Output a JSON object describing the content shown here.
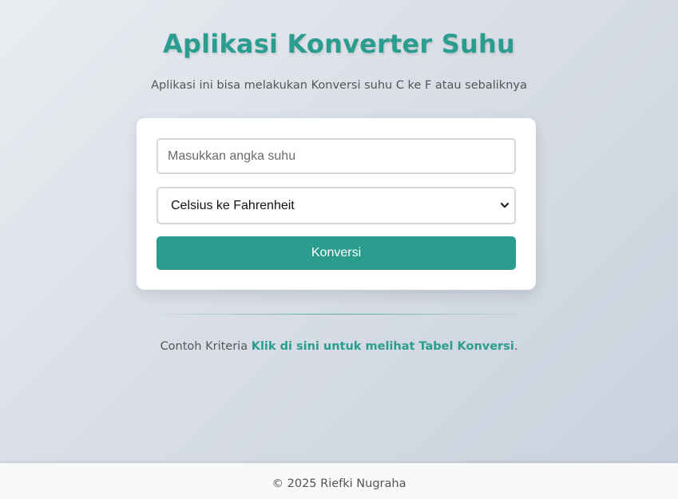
{
  "header": {
    "title": "Aplikasi Konverter Suhu",
    "description": "Aplikasi ini bisa melakukan Konversi suhu C ke F atau sebaliknya"
  },
  "form": {
    "input_placeholder": "Masukkan angka suhu",
    "input_value": "",
    "select_value": "Celsius ke Fahrenheit",
    "select_caret_icon": "chevron-down-icon",
    "button_label": "Konversi"
  },
  "criteria": {
    "prefix": "Contoh Kriteria",
    "link_text": "Klik di sini untuk melihat Tabel Konversi",
    "suffix": "."
  },
  "footer": {
    "text": "© 2025 Riefki Nugraha"
  },
  "colors": {
    "accent": "#2a9d8f",
    "text": "#555555",
    "card": "#ffffff"
  }
}
